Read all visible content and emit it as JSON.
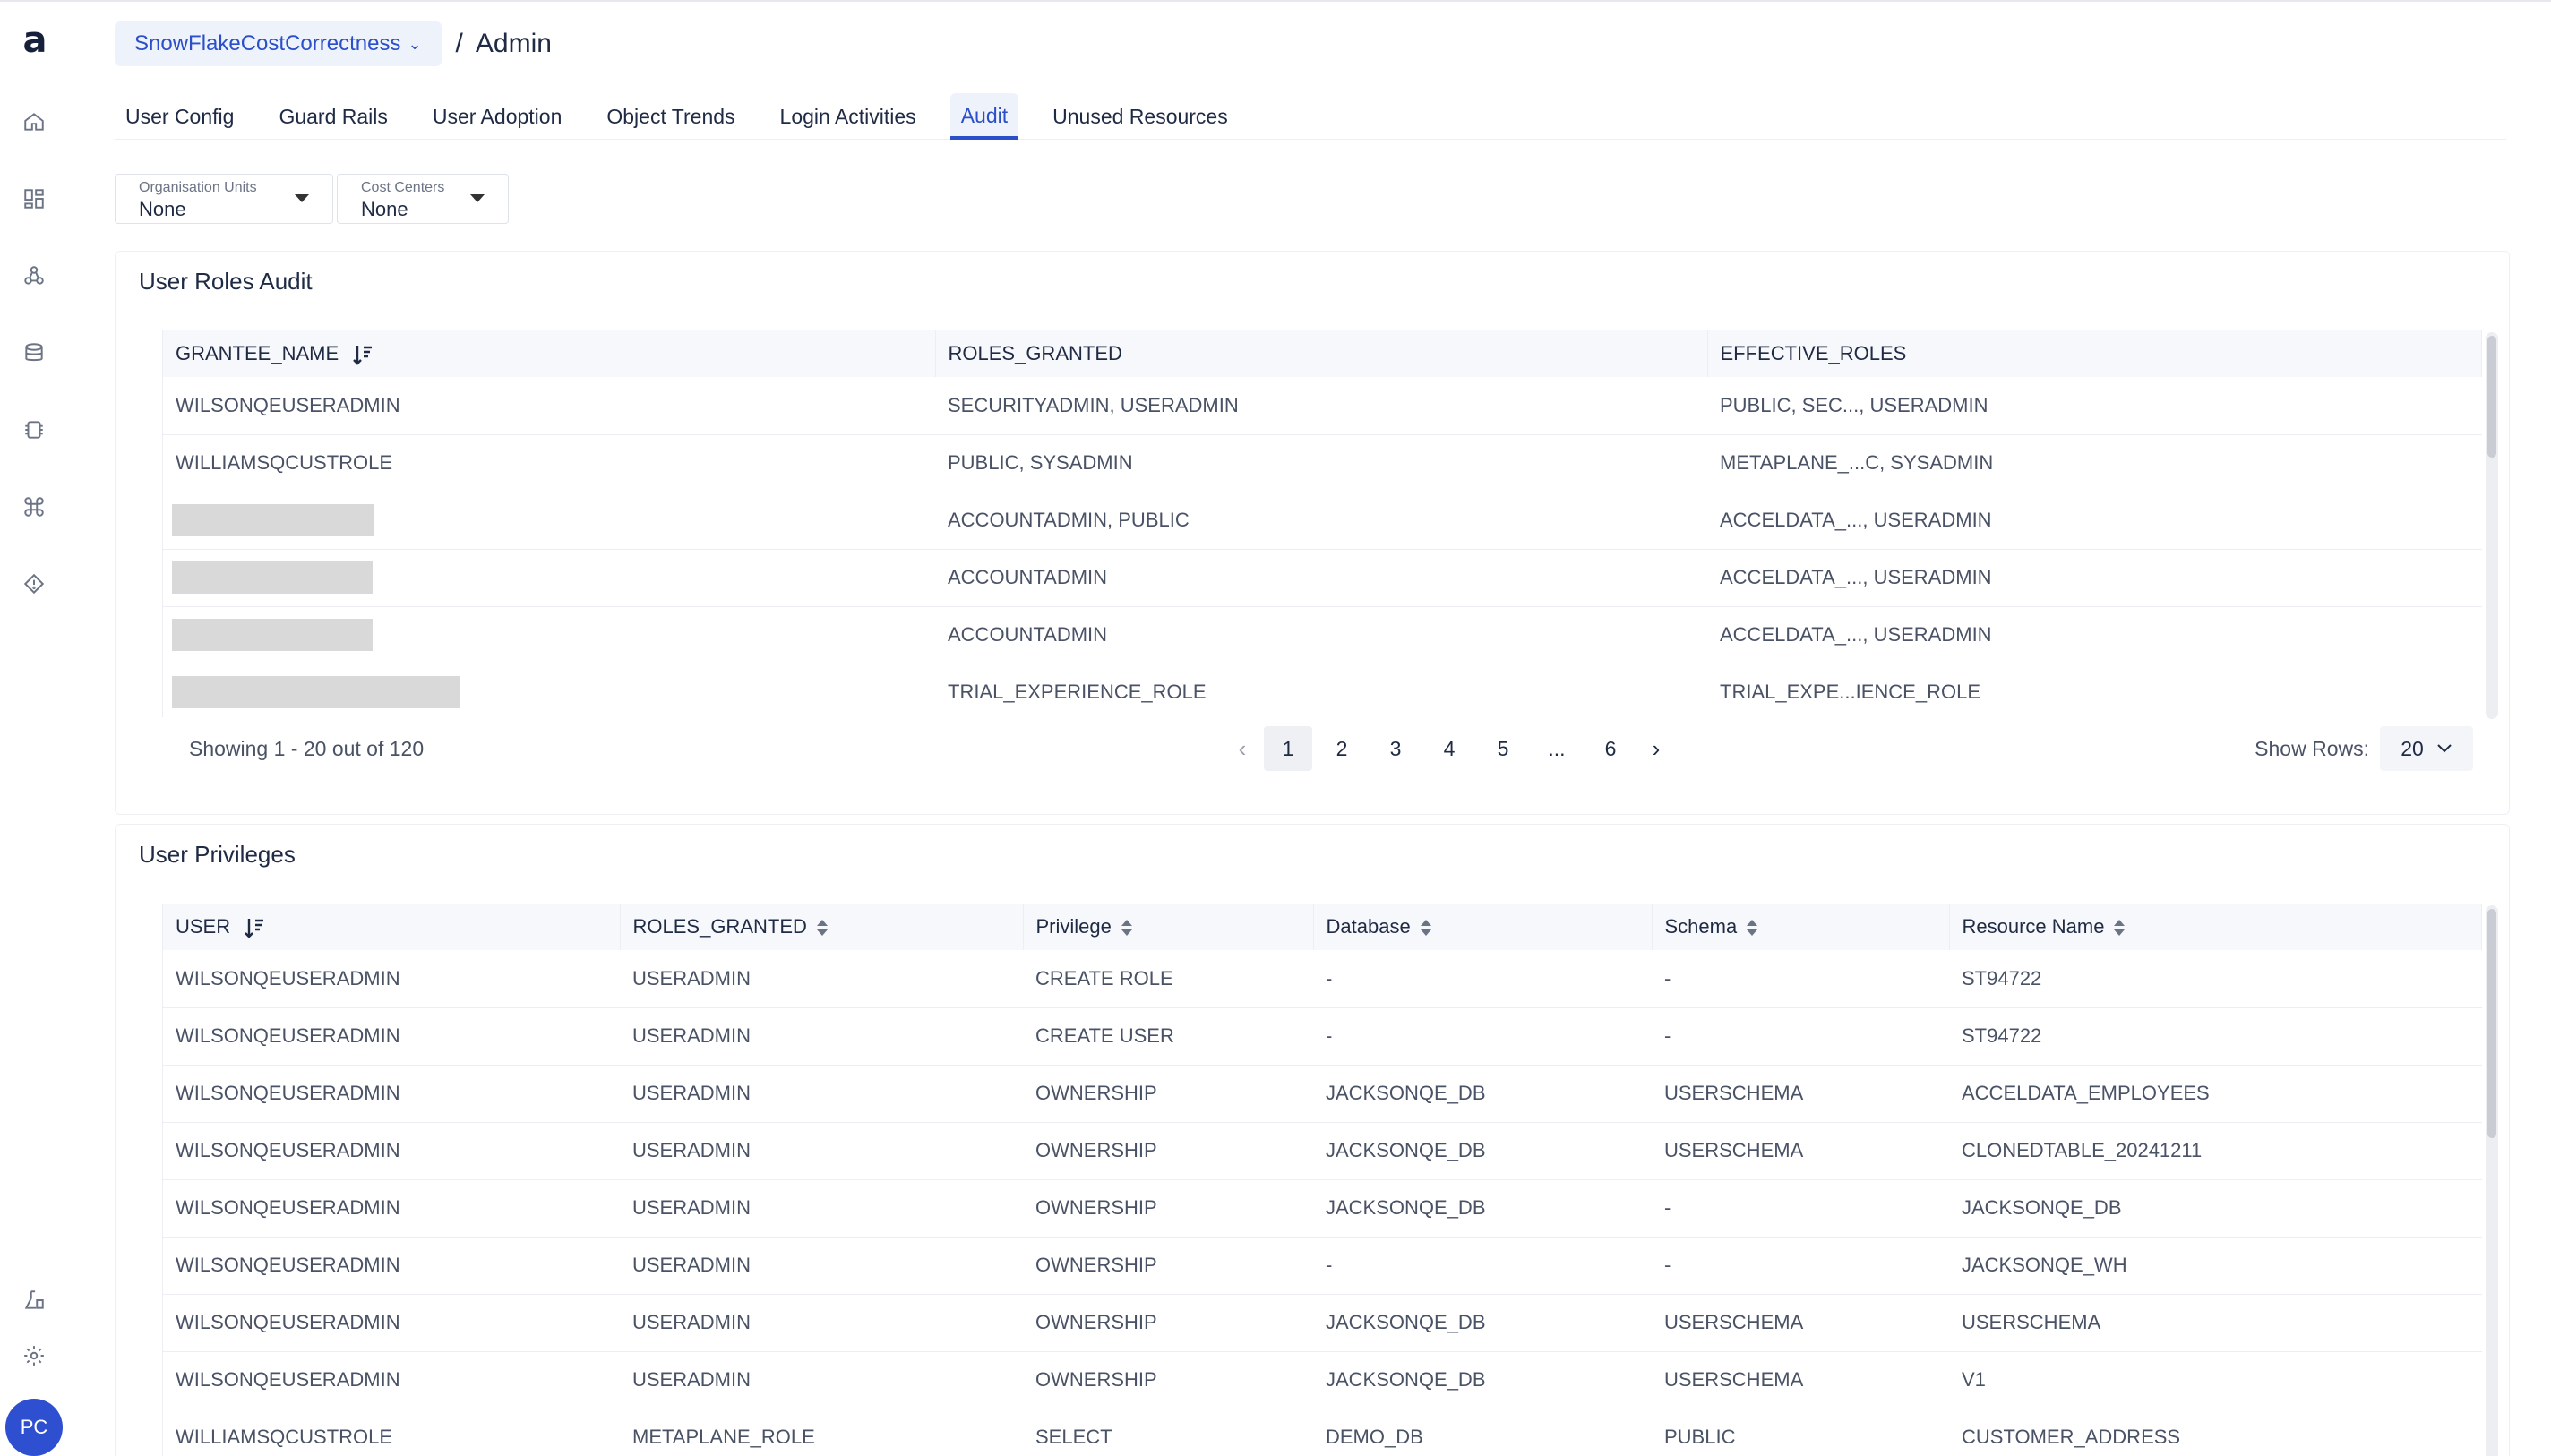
{
  "header": {
    "workspace": "SnowFlakeCostCorrectness",
    "separator": "/",
    "title": "Admin"
  },
  "sidebar": {
    "logo": "a",
    "avatar": "PC",
    "icons": [
      "home-icon",
      "dashboard-icon",
      "network-icon",
      "database-icon",
      "cpu-icon",
      "command-icon",
      "diamond-icon",
      "flask-icon",
      "gear-icon"
    ]
  },
  "tabs": [
    {
      "label": "User Config",
      "active": false
    },
    {
      "label": "Guard Rails",
      "active": false
    },
    {
      "label": "User Adoption",
      "active": false
    },
    {
      "label": "Object Trends",
      "active": false
    },
    {
      "label": "Login Activities",
      "active": false
    },
    {
      "label": "Audit",
      "active": true
    },
    {
      "label": "Unused Resources",
      "active": false
    }
  ],
  "filters": {
    "org_units": {
      "label": "Organisation Units",
      "value": "None"
    },
    "cost_centers": {
      "label": "Cost Centers",
      "value": "None"
    }
  },
  "roles_audit": {
    "title": "User Roles Audit",
    "columns": [
      "GRANTEE_NAME",
      "ROLES_GRANTED",
      "EFFECTIVE_ROLES"
    ],
    "rows": [
      {
        "grantee": "WILSONQEUSERADMIN",
        "roles": "SECURITYADMIN, USERADMIN",
        "effective": "PUBLIC, SEC..., USERADMIN"
      },
      {
        "grantee": "WILLIAMSQCUSTROLE",
        "roles": "PUBLIC, SYSADMIN",
        "effective": "METAPLANE_...C, SYSADMIN"
      },
      {
        "grantee": "",
        "roles": "ACCOUNTADMIN, PUBLIC",
        "effective": "ACCELDATA_..., USERADMIN"
      },
      {
        "grantee": "",
        "roles": "ACCOUNTADMIN",
        "effective": "ACCELDATA_..., USERADMIN"
      },
      {
        "grantee": "",
        "roles": "ACCOUNTADMIN",
        "effective": "ACCELDATA_..., USERADMIN"
      },
      {
        "grantee": "",
        "roles": "TRIAL_EXPERIENCE_ROLE",
        "effective": "TRIAL_EXPE...IENCE_ROLE"
      }
    ],
    "pagination": {
      "showing": "Showing 1 - 20 out of 120",
      "prev": "‹",
      "pages": [
        "1",
        "2",
        "3",
        "4",
        "5",
        "...",
        "6"
      ],
      "next": "›",
      "current": "1",
      "rows_label": "Show Rows:",
      "rows_value": "20"
    }
  },
  "privileges": {
    "title": "User Privileges",
    "columns": [
      "USER",
      "ROLES_GRANTED",
      "Privilege",
      "Database",
      "Schema",
      "Resource Name"
    ],
    "rows": [
      [
        "WILSONQEUSERADMIN",
        "USERADMIN",
        "CREATE ROLE",
        "-",
        "-",
        "ST94722"
      ],
      [
        "WILSONQEUSERADMIN",
        "USERADMIN",
        "CREATE USER",
        "-",
        "-",
        "ST94722"
      ],
      [
        "WILSONQEUSERADMIN",
        "USERADMIN",
        "OWNERSHIP",
        "JACKSONQE_DB",
        "USERSCHEMA",
        "ACCELDATA_EMPLOYEES"
      ],
      [
        "WILSONQEUSERADMIN",
        "USERADMIN",
        "OWNERSHIP",
        "JACKSONQE_DB",
        "USERSCHEMA",
        "CLONEDTABLE_20241211"
      ],
      [
        "WILSONQEUSERADMIN",
        "USERADMIN",
        "OWNERSHIP",
        "JACKSONQE_DB",
        "-",
        "JACKSONQE_DB"
      ],
      [
        "WILSONQEUSERADMIN",
        "USERADMIN",
        "OWNERSHIP",
        "-",
        "-",
        "JACKSONQE_WH"
      ],
      [
        "WILSONQEUSERADMIN",
        "USERADMIN",
        "OWNERSHIP",
        "JACKSONQE_DB",
        "USERSCHEMA",
        "USERSCHEMA"
      ],
      [
        "WILSONQEUSERADMIN",
        "USERADMIN",
        "OWNERSHIP",
        "JACKSONQE_DB",
        "USERSCHEMA",
        "V1"
      ],
      [
        "WILLIAMSQCUSTROLE",
        "METAPLANE_ROLE",
        "SELECT",
        "DEMO_DB",
        "PUBLIC",
        "CUSTOMER_ADDRESS"
      ]
    ]
  }
}
